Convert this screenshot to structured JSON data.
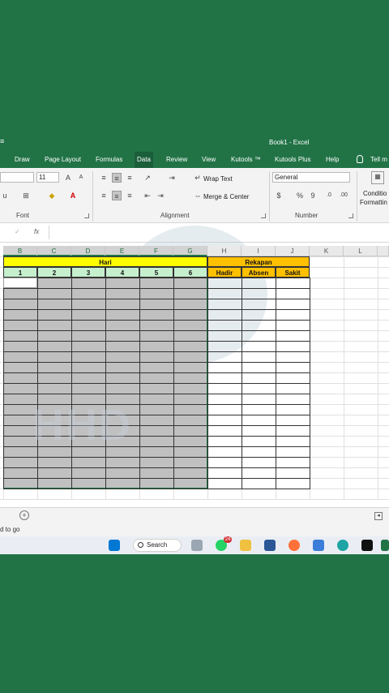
{
  "window": {
    "title": "Book1 - Excel"
  },
  "tabs": [
    "Draw",
    "Page Layout",
    "Formulas",
    "Data",
    "Review",
    "View",
    "Kutools ™",
    "Kutools Plus",
    "Help",
    "Tell m"
  ],
  "ribbon": {
    "font_size": "11",
    "font_group_label": "Font",
    "alignment_group_label": "Alignment",
    "number_group_label": "Number",
    "wrap_text": "Wrap Text",
    "merge_center": "Merge & Center",
    "number_format": "General",
    "conditional_label_1": "Conditio",
    "conditional_label_2": "Formattin",
    "currency": "$",
    "percent": "%",
    "comma": "9"
  },
  "formula_bar": {
    "fx": "fx"
  },
  "columns": [
    "B",
    "C",
    "D",
    "E",
    "F",
    "G",
    "H",
    "I",
    "J",
    "K",
    "L"
  ],
  "sheet": {
    "header_hari": "Hari",
    "header_rekapan": "Rekapan",
    "days": [
      "1",
      "2",
      "3",
      "4",
      "5",
      "6"
    ],
    "rekap": [
      "Hadir",
      "Absen",
      "Sakit"
    ]
  },
  "status": {
    "ready": "d to go"
  },
  "taskbar": {
    "search": "Search",
    "whatsapp_badge": "24"
  },
  "colors": {
    "accent": "#217346",
    "hari_fill": "#ffff00",
    "days_fill": "#c6efce",
    "rekap_fill": "#ffc000",
    "selection": "#c0c0c0"
  }
}
